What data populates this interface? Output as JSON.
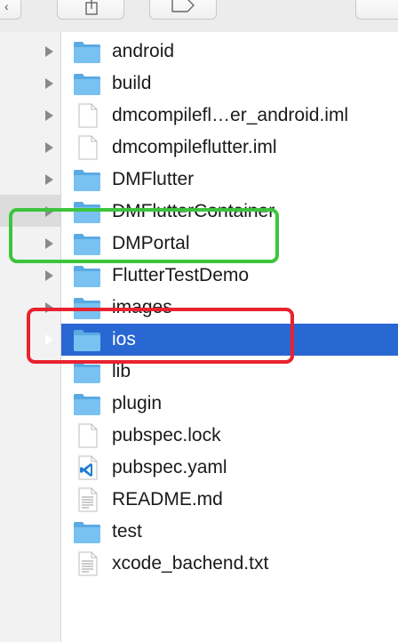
{
  "toolbar": {
    "back_icon": "chevron-left-icon",
    "share_icon": "share-icon",
    "tag_icon": "tag-icon"
  },
  "file_list": {
    "items": [
      {
        "name": "android",
        "icon": "folder-icon",
        "expandable": true,
        "selected": false
      },
      {
        "name": "build",
        "icon": "folder-icon",
        "expandable": true,
        "selected": false
      },
      {
        "name": "dmcompilefl…er_android.iml",
        "icon": "document-icon",
        "expandable": true,
        "selected": false
      },
      {
        "name": "dmcompileflutter.iml",
        "icon": "document-icon",
        "expandable": true,
        "selected": false
      },
      {
        "name": "DMFlutter",
        "icon": "folder-icon",
        "expandable": true,
        "selected": false
      },
      {
        "name": "DMFlutterContainer",
        "icon": "folder-icon",
        "expandable": true,
        "selected": false
      },
      {
        "name": "DMPortal",
        "icon": "folder-icon",
        "expandable": true,
        "selected": false
      },
      {
        "name": "FlutterTestDemo",
        "icon": "folder-icon",
        "expandable": true,
        "selected": false
      },
      {
        "name": "images",
        "icon": "folder-icon",
        "expandable": true,
        "selected": false
      },
      {
        "name": "ios",
        "icon": "folder-icon",
        "expandable": true,
        "selected": true
      },
      {
        "name": "lib",
        "icon": "folder-icon",
        "expandable": false,
        "selected": false
      },
      {
        "name": "plugin",
        "icon": "folder-icon",
        "expandable": false,
        "selected": false
      },
      {
        "name": "pubspec.lock",
        "icon": "document-icon",
        "expandable": false,
        "selected": false
      },
      {
        "name": "pubspec.yaml",
        "icon": "vscode-document-icon",
        "expandable": false,
        "selected": false
      },
      {
        "name": "README.md",
        "icon": "text-document-icon",
        "expandable": false,
        "selected": false
      },
      {
        "name": "test",
        "icon": "folder-icon",
        "expandable": false,
        "selected": false
      },
      {
        "name": "xcode_bachend.txt",
        "icon": "text-document-icon",
        "expandable": false,
        "selected": false
      }
    ]
  },
  "annotations": {
    "green_box_color": "#3cc43c",
    "red_box_color": "#e8222e"
  },
  "colors": {
    "selection": "#2967d2",
    "folder": "#6cb8ec"
  }
}
